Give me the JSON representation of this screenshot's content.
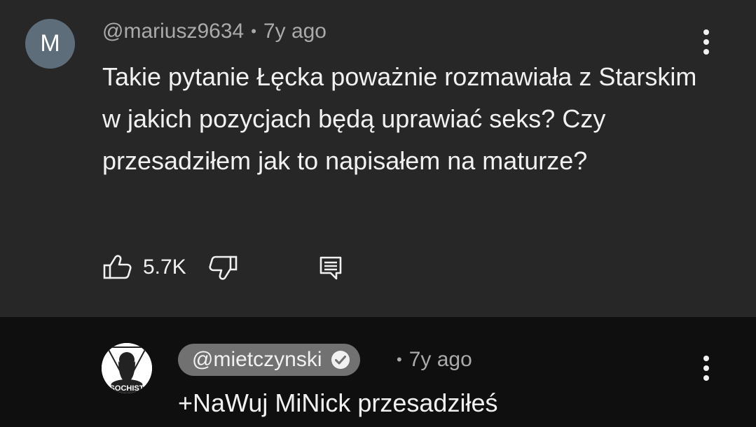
{
  "comment": {
    "avatar_letter": "M",
    "author": "@mariusz9634",
    "separator": "•",
    "time": "7y ago",
    "text": "Takie pytanie Łęcka poważnie rozmawiała z Starskim w jakich pozycjach będą uprawiać seks? Czy przesadziłem jak to napisałem na maturze?",
    "like_count": "5.7K",
    "icons": [
      "more-vertical-icon",
      "thumbs-up-icon",
      "thumbs-down-icon",
      "reply-icon"
    ]
  },
  "reply": {
    "author": "@mietczynski",
    "separator": "•",
    "time": "7y ago",
    "text": "+NaWuj MiNick przesadziłeś",
    "avatar_text": "SOCHIST",
    "icons": [
      "verified-badge-icon",
      "more-vertical-icon"
    ]
  },
  "colors": {
    "card_background": "#272727",
    "page_background": "#0f0f0f",
    "avatar_background": "#5d6d7a",
    "author_chip_background": "#717171",
    "secondary_text": "#aaaaaa",
    "primary_text": "#f1f1f1"
  }
}
